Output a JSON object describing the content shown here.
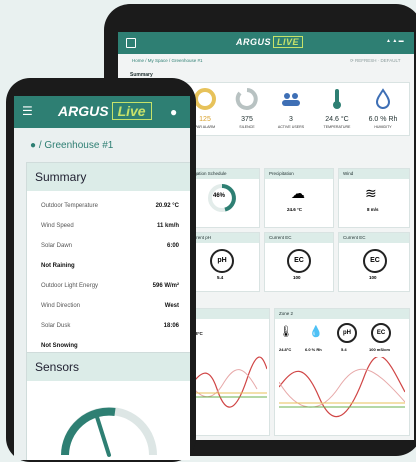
{
  "colors": {
    "brand": "#2e7f73",
    "accent": "#c6e26a",
    "header_bg": "#dcece8"
  },
  "tablet": {
    "logo_main": "ARGUS",
    "logo_live": "LIVE",
    "breadcrumb": "Home / My Space / Greenhouse #1",
    "refresh": "⟳ REFRESH · DEFAULT",
    "summary_label": "Summary",
    "metrics": [
      {
        "value": "",
        "label": "",
        "icon": "gauge-icon"
      },
      {
        "value": "125",
        "label": "PAR ALARM",
        "icon": "ring-icon"
      },
      {
        "value": "375",
        "label": "SILENCE",
        "icon": "ring-grey-icon"
      },
      {
        "value": "3",
        "label": "ACTIVE USERS",
        "icon": "users-icon"
      },
      {
        "value": "24.6 °C",
        "label": "TEMPERATURE",
        "icon": "thermometer-icon"
      },
      {
        "value": "6.0 % Rh",
        "label": "HUMIDITY",
        "icon": "droplet-icon"
      }
    ],
    "cards_row1": [
      {
        "title": "Irrigation Schedule",
        "value": "46%",
        "sub": "irrigation complete"
      },
      {
        "title": "Precipitation",
        "value": "24.6 °C",
        "sub": "Outdoor Humidity"
      },
      {
        "title": "Wind",
        "value": "8 m/s",
        "sub": "SW"
      }
    ],
    "cards_row2": [
      {
        "title": "Current pH",
        "symbol": "pH",
        "value": "5.4",
        "sub": "mS/cm"
      },
      {
        "title": "Current EC",
        "symbol": "EC",
        "value": "100",
        "sub": "mS/cm"
      },
      {
        "title": "Current EC",
        "symbol": "EC",
        "value": "100",
        "sub": "mS/cm"
      }
    ],
    "zone2": {
      "title": "Zone 2",
      "vals": [
        "24.8°C",
        "6.0 % Rh",
        "5.4",
        "100 mS/cm"
      ]
    },
    "zone1": {
      "vals": [
        "24.8°C"
      ]
    }
  },
  "phone": {
    "logo_main": "ARGUS",
    "logo_live": "Live",
    "breadcrumb": "/ Greenhouse #1",
    "summary_title": "Summary",
    "rows": [
      {
        "label": "Outdoor Temperature",
        "value": "20.92 °C"
      },
      {
        "label": "Wind Speed",
        "value": "11 km/h"
      },
      {
        "label": "Solar Dawn",
        "value": "6:00"
      },
      {
        "label": "Not Raining",
        "value": ""
      },
      {
        "label": "Outdoor Light Energy",
        "value": "596 W/m²"
      },
      {
        "label": "Wind Direction",
        "value": "West"
      },
      {
        "label": "Solar Dusk",
        "value": "18:06"
      },
      {
        "label": "Not Snowing",
        "value": ""
      }
    ],
    "sensors_title": "Sensors"
  }
}
